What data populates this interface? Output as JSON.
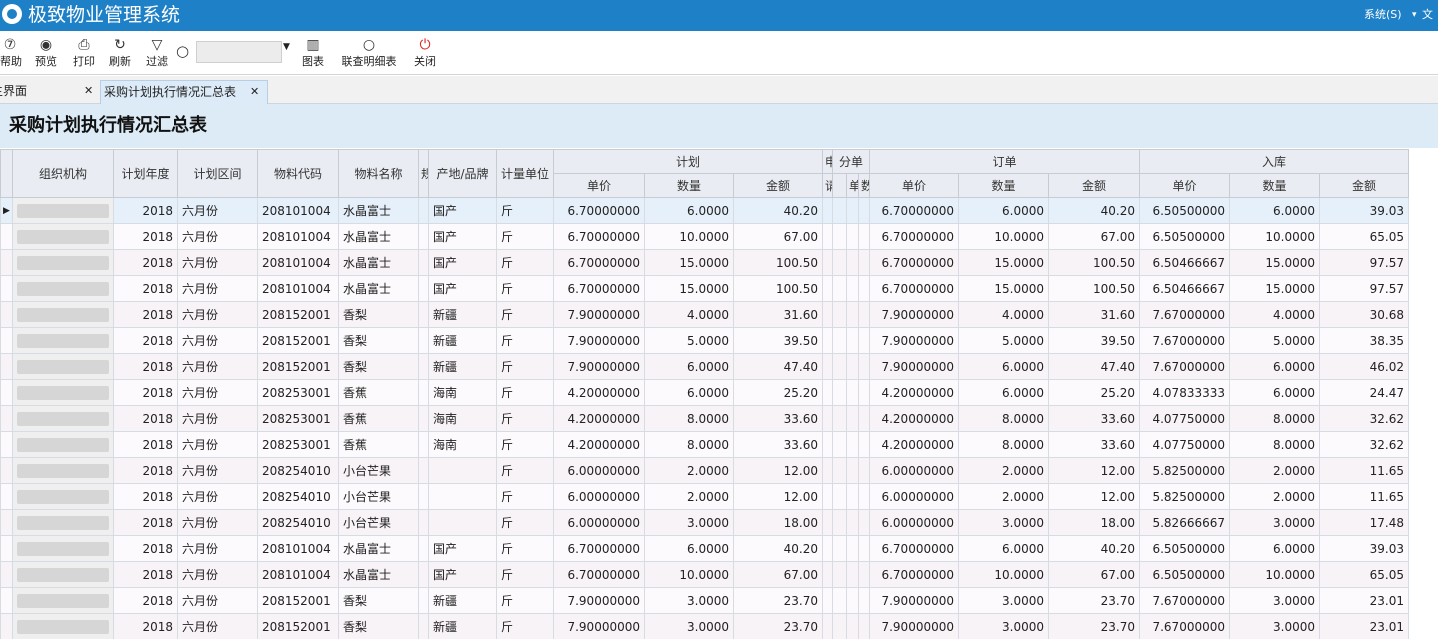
{
  "app": {
    "title": "极致物业管理系统",
    "menus": [
      "系统(S)",
      "文"
    ]
  },
  "toolbar": {
    "buttons": [
      {
        "label": "帮助",
        "icon": "help-icon",
        "glyph": "⑦"
      },
      {
        "label": "预览",
        "icon": "eye-icon",
        "glyph": "◉"
      },
      {
        "label": "打印",
        "icon": "printer-icon",
        "glyph": "⎙"
      },
      {
        "label": "刷新",
        "icon": "refresh-icon",
        "glyph": "↻"
      },
      {
        "label": "过滤",
        "icon": "filter-icon",
        "glyph": "▽"
      },
      {
        "label": "图表",
        "icon": "chart-icon",
        "glyph": "▥"
      },
      {
        "label": "联查明细表",
        "icon": "search-icon",
        "glyph": "○"
      },
      {
        "label": "关闭",
        "icon": "power-icon",
        "glyph": "⏻"
      }
    ],
    "search_value": ""
  },
  "tabs": [
    {
      "label": "主界面",
      "close": "✕"
    },
    {
      "label": "采购计划执行情况汇总表",
      "close": "✕"
    }
  ],
  "report": {
    "title": "采购计划执行情况汇总表",
    "header_top": [
      "组织机构",
      "计划年度",
      "计划区间",
      "物料代码",
      "物料名称",
      "规",
      "产地/品牌",
      "计量单位",
      "计划",
      "申",
      "分单",
      "订单",
      "入库"
    ],
    "header_sub": [
      "单价",
      "数量",
      "金额",
      "请",
      "单",
      "数",
      "单价",
      "数量",
      "金额",
      "单价",
      "数量",
      "金额"
    ],
    "rows": [
      [
        "2018",
        "六月份",
        "208101004",
        "水晶富士",
        "国产",
        "斤",
        "6.70000000",
        "6.0000",
        "40.20",
        "6.70000000",
        "6.0000",
        "40.20",
        "6.50500000",
        "6.0000",
        "39.03"
      ],
      [
        "2018",
        "六月份",
        "208101004",
        "水晶富士",
        "国产",
        "斤",
        "6.70000000",
        "10.0000",
        "67.00",
        "6.70000000",
        "10.0000",
        "67.00",
        "6.50500000",
        "10.0000",
        "65.05"
      ],
      [
        "2018",
        "六月份",
        "208101004",
        "水晶富士",
        "国产",
        "斤",
        "6.70000000",
        "15.0000",
        "100.50",
        "6.70000000",
        "15.0000",
        "100.50",
        "6.50466667",
        "15.0000",
        "97.57"
      ],
      [
        "2018",
        "六月份",
        "208101004",
        "水晶富士",
        "国产",
        "斤",
        "6.70000000",
        "15.0000",
        "100.50",
        "6.70000000",
        "15.0000",
        "100.50",
        "6.50466667",
        "15.0000",
        "97.57"
      ],
      [
        "2018",
        "六月份",
        "208152001",
        "香梨",
        "新疆",
        "斤",
        "7.90000000",
        "4.0000",
        "31.60",
        "7.90000000",
        "4.0000",
        "31.60",
        "7.67000000",
        "4.0000",
        "30.68"
      ],
      [
        "2018",
        "六月份",
        "208152001",
        "香梨",
        "新疆",
        "斤",
        "7.90000000",
        "5.0000",
        "39.50",
        "7.90000000",
        "5.0000",
        "39.50",
        "7.67000000",
        "5.0000",
        "38.35"
      ],
      [
        "2018",
        "六月份",
        "208152001",
        "香梨",
        "新疆",
        "斤",
        "7.90000000",
        "6.0000",
        "47.40",
        "7.90000000",
        "6.0000",
        "47.40",
        "7.67000000",
        "6.0000",
        "46.02"
      ],
      [
        "2018",
        "六月份",
        "208253001",
        "香蕉",
        "海南",
        "斤",
        "4.20000000",
        "6.0000",
        "25.20",
        "4.20000000",
        "6.0000",
        "25.20",
        "4.07833333",
        "6.0000",
        "24.47"
      ],
      [
        "2018",
        "六月份",
        "208253001",
        "香蕉",
        "海南",
        "斤",
        "4.20000000",
        "8.0000",
        "33.60",
        "4.20000000",
        "8.0000",
        "33.60",
        "4.07750000",
        "8.0000",
        "32.62"
      ],
      [
        "2018",
        "六月份",
        "208253001",
        "香蕉",
        "海南",
        "斤",
        "4.20000000",
        "8.0000",
        "33.60",
        "4.20000000",
        "8.0000",
        "33.60",
        "4.07750000",
        "8.0000",
        "32.62"
      ],
      [
        "2018",
        "六月份",
        "208254010",
        "小台芒果",
        "",
        "斤",
        "6.00000000",
        "2.0000",
        "12.00",
        "6.00000000",
        "2.0000",
        "12.00",
        "5.82500000",
        "2.0000",
        "11.65"
      ],
      [
        "2018",
        "六月份",
        "208254010",
        "小台芒果",
        "",
        "斤",
        "6.00000000",
        "2.0000",
        "12.00",
        "6.00000000",
        "2.0000",
        "12.00",
        "5.82500000",
        "2.0000",
        "11.65"
      ],
      [
        "2018",
        "六月份",
        "208254010",
        "小台芒果",
        "",
        "斤",
        "6.00000000",
        "3.0000",
        "18.00",
        "6.00000000",
        "3.0000",
        "18.00",
        "5.82666667",
        "3.0000",
        "17.48"
      ],
      [
        "2018",
        "六月份",
        "208101004",
        "水晶富士",
        "国产",
        "斤",
        "6.70000000",
        "6.0000",
        "40.20",
        "6.70000000",
        "6.0000",
        "40.20",
        "6.50500000",
        "6.0000",
        "39.03"
      ],
      [
        "2018",
        "六月份",
        "208101004",
        "水晶富士",
        "国产",
        "斤",
        "6.70000000",
        "10.0000",
        "67.00",
        "6.70000000",
        "10.0000",
        "67.00",
        "6.50500000",
        "10.0000",
        "65.05"
      ],
      [
        "2018",
        "六月份",
        "208152001",
        "香梨",
        "新疆",
        "斤",
        "7.90000000",
        "3.0000",
        "23.70",
        "7.90000000",
        "3.0000",
        "23.70",
        "7.67000000",
        "3.0000",
        "23.01"
      ],
      [
        "2018",
        "六月份",
        "208152001",
        "香梨",
        "新疆",
        "斤",
        "7.90000000",
        "3.0000",
        "23.70",
        "7.90000000",
        "3.0000",
        "23.70",
        "7.67000000",
        "3.0000",
        "23.01"
      ]
    ]
  },
  "colors": {
    "titlebar": "#1e80c6",
    "header_bg": "#e9ecf2",
    "title_band": "#dcebf6"
  }
}
